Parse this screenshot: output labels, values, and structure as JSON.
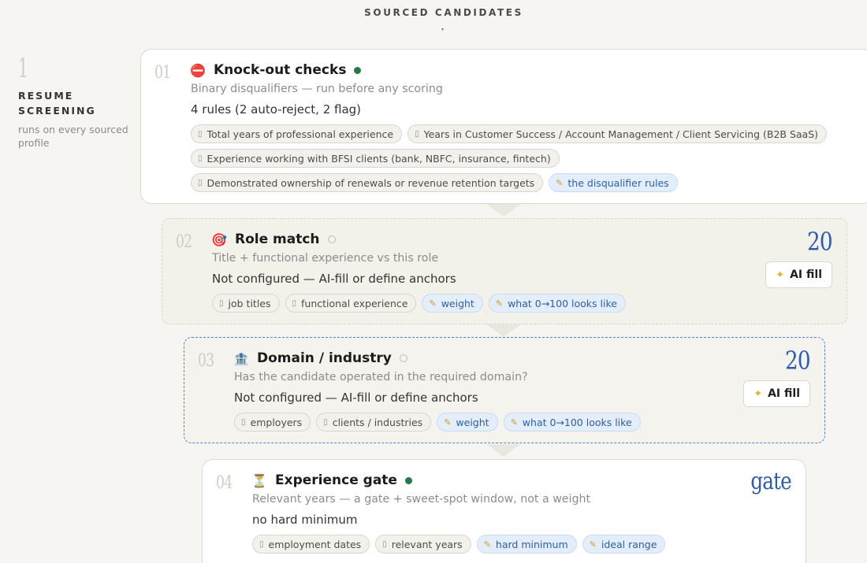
{
  "header": {
    "label": "SOURCED CANDIDATES",
    "caret": "▾"
  },
  "stage": {
    "number": "1",
    "title": "RESUME SCREENING",
    "subtitle": "runs on every sourced profile"
  },
  "cards": [
    {
      "index": "01",
      "icon": "no-entry-icon",
      "emoji": "⛔",
      "title": "Knock-out checks",
      "active": true,
      "description": "Binary disqualifiers — run before any scoring",
      "status": "4 rules (2 auto-reject, 2 flag)",
      "chips": [
        {
          "label": "Total years of professional experience",
          "kind": "doc"
        },
        {
          "label": "Years in Customer Success / Account Management / Client Servicing (B2B SaaS)",
          "kind": "doc"
        },
        {
          "label": "Experience working with BFSI clients (bank, NBFC, insurance, fintech)",
          "kind": "doc"
        },
        {
          "label": "Demonstrated ownership of renewals or revenue retention targets",
          "kind": "doc"
        },
        {
          "label": "the disqualifier rules",
          "kind": "edit"
        }
      ]
    },
    {
      "index": "02",
      "icon": "target-icon",
      "emoji": "🎯",
      "title": "Role match",
      "active": false,
      "description": "Title + functional experience vs this role",
      "status": "Not configured — AI-fill or define anchors",
      "score": "20",
      "ai_fill_label": "AI fill",
      "chips": [
        {
          "label": "job titles",
          "kind": "doc"
        },
        {
          "label": "functional experience",
          "kind": "doc"
        },
        {
          "label": "weight",
          "kind": "edit"
        },
        {
          "label": "what 0→100 looks like",
          "kind": "edit"
        }
      ]
    },
    {
      "index": "03",
      "icon": "bank-icon",
      "emoji": "🏦",
      "title": "Domain / industry",
      "active": false,
      "description": "Has the candidate operated in the required domain?",
      "status": "Not configured — AI-fill or define anchors",
      "score": "20",
      "ai_fill_label": "AI fill",
      "chips": [
        {
          "label": "employers",
          "kind": "doc"
        },
        {
          "label": "clients / industries",
          "kind": "doc"
        },
        {
          "label": "weight",
          "kind": "edit"
        },
        {
          "label": "what 0→100 looks like",
          "kind": "edit"
        }
      ]
    },
    {
      "index": "04",
      "icon": "hourglass-icon",
      "emoji": "⏳",
      "title": "Experience gate",
      "active": true,
      "description": "Relevant years — a gate + sweet-spot window, not a weight",
      "status": "no hard minimum",
      "score": "gate",
      "chips": [
        {
          "label": "employment dates",
          "kind": "doc"
        },
        {
          "label": "relevant years",
          "kind": "doc"
        },
        {
          "label": "hard minimum",
          "kind": "edit"
        },
        {
          "label": "ideal range",
          "kind": "edit"
        }
      ]
    }
  ],
  "icons": {
    "doc": "document-icon",
    "edit": "pencil-icon",
    "spark": "sparkles-icon"
  },
  "colors": {
    "accent_blue": "#2c5bb5",
    "active_dot": "#237a45",
    "focus_border": "#4d84d0"
  }
}
